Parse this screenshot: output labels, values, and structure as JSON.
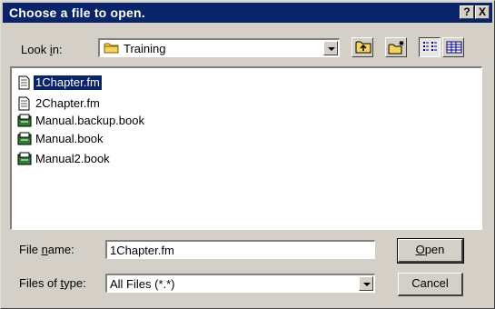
{
  "window": {
    "title": "Choose a file to open.",
    "help_label": "?",
    "close_label": "X"
  },
  "look_in": {
    "label_pre": "Look ",
    "label_accel": "i",
    "label_post": "n:",
    "value": "Training",
    "folder_icon": "folder-icon"
  },
  "toolbar": {
    "up_icon": "up-one-level-icon",
    "new_folder_icon": "new-folder-icon",
    "list_icon": "list-view-icon",
    "details_icon": "details-view-icon"
  },
  "files": [
    {
      "name": "1Chapter.fm",
      "icon": "fm-document-icon",
      "selected": true
    },
    {
      "name": "2Chapter.fm",
      "icon": "fm-document-icon",
      "selected": false
    },
    {
      "name": "Manual.backup.book",
      "icon": "book-icon",
      "selected": false
    },
    {
      "name": "Manual.book",
      "icon": "book-icon",
      "selected": false
    },
    {
      "name": "Manual2.book",
      "icon": "book-icon",
      "selected": false
    }
  ],
  "file_name": {
    "label_pre": "File ",
    "label_accel": "n",
    "label_post": "ame:",
    "value": "1Chapter.fm"
  },
  "file_type": {
    "label_pre": "Files of ",
    "label_accel": "t",
    "label_post": "ype:",
    "value": "All Files (*.*)"
  },
  "buttons": {
    "open_accel": "O",
    "open_rest": "pen",
    "cancel": "Cancel"
  }
}
